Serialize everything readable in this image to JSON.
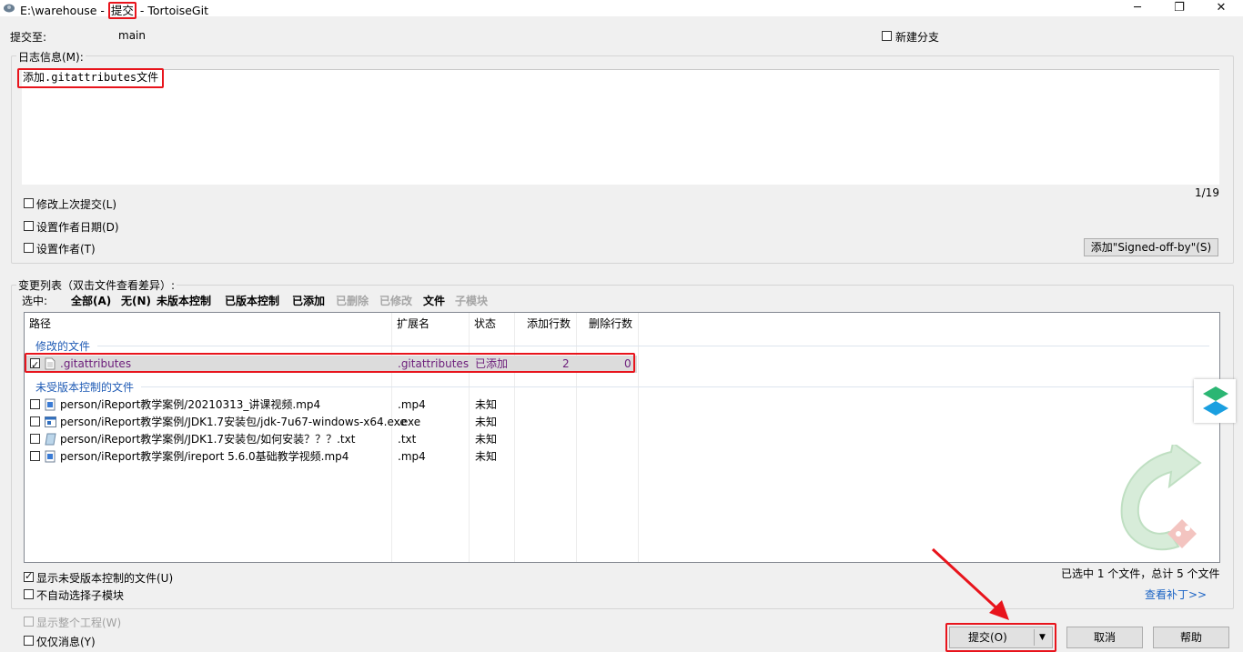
{
  "window": {
    "title_path": "E:\\warehouse - ",
    "title_action": "提交",
    "title_app": " - TortoiseGit",
    "minimize_glyph": "─",
    "maximize_glyph": "❐",
    "close_glyph": "✕"
  },
  "commit_to": {
    "label": "提交至:",
    "branch": "main"
  },
  "new_branch": {
    "label": "新建分支",
    "checked": false
  },
  "message": {
    "group_label": "日志信息(M):",
    "text": "添加.gitattributes文件",
    "counter": "1/19"
  },
  "options": [
    {
      "label": "修改上次提交(L)",
      "checked": false
    },
    {
      "label": "设置作者日期(D)",
      "checked": false
    },
    {
      "label": "设置作者(T)",
      "checked": false
    }
  ],
  "signed_off_button": "添加\"Signed-off-by\"(S)",
  "changes": {
    "group_label": "变更列表（双击文件查看差异）:",
    "select_label": "选中:",
    "filters": [
      {
        "label": "全部(A)",
        "enabled": true
      },
      {
        "label": "无(N)",
        "enabled": true
      },
      {
        "label": "未版本控制",
        "enabled": true
      },
      {
        "label": "已版本控制",
        "enabled": true
      },
      {
        "label": "已添加",
        "enabled": true
      },
      {
        "label": "已删除",
        "enabled": false
      },
      {
        "label": "已修改",
        "enabled": false
      },
      {
        "label": "文件",
        "enabled": true
      },
      {
        "label": "子模块",
        "enabled": false
      }
    ],
    "columns": [
      "路径",
      "扩展名",
      "状态",
      "添加行数",
      "删除行数"
    ],
    "groups": [
      {
        "name": "修改的文件",
        "rows": [
          {
            "checked": true,
            "icon": "text-file-icon",
            "path": ".gitattributes",
            "ext": ".gitattributes",
            "status": "已添加",
            "added": "2",
            "deleted": "0"
          }
        ]
      },
      {
        "name": "未受版本控制的文件",
        "rows": [
          {
            "checked": false,
            "icon": "video-file-icon",
            "path": "person/iReport教学案例/20210313_讲课视频.mp4",
            "ext": ".mp4",
            "status": "未知",
            "added": "",
            "deleted": ""
          },
          {
            "checked": false,
            "icon": "exe-file-icon",
            "path": "person/iReport教学案例/JDK1.7安装包/jdk-7u67-windows-x64.exe",
            "ext": ".exe",
            "status": "未知",
            "added": "",
            "deleted": ""
          },
          {
            "checked": false,
            "icon": "notepad-file-icon",
            "path": "person/iReport教学案例/JDK1.7安装包/如何安装？？？.txt",
            "ext": ".txt",
            "status": "未知",
            "added": "",
            "deleted": ""
          },
          {
            "checked": false,
            "icon": "video-file-icon",
            "path": "person/iReport教学案例/ireport 5.6.0基础教学视频.mp4",
            "ext": ".mp4",
            "status": "未知",
            "added": "",
            "deleted": ""
          }
        ]
      }
    ]
  },
  "bottom_options": [
    {
      "label": "显示未受版本控制的文件(U)",
      "checked": true,
      "enabled": true
    },
    {
      "label": "不自动选择子模块",
      "checked": false,
      "enabled": true
    },
    {
      "label": "显示整个工程(W)",
      "checked": false,
      "enabled": false
    },
    {
      "label": "仅仅消息(Y)",
      "checked": false,
      "enabled": true
    }
  ],
  "selection_summary": "已选中 1 个文件，总计 5 个文件",
  "view_patch_link": "查看补丁>>",
  "buttons": {
    "commit": "提交(O)",
    "cancel": "取消",
    "help": "帮助"
  },
  "colors": {
    "highlight": "#e8141c",
    "link": "#1a63c4",
    "status_added": "#6b1c7a"
  }
}
